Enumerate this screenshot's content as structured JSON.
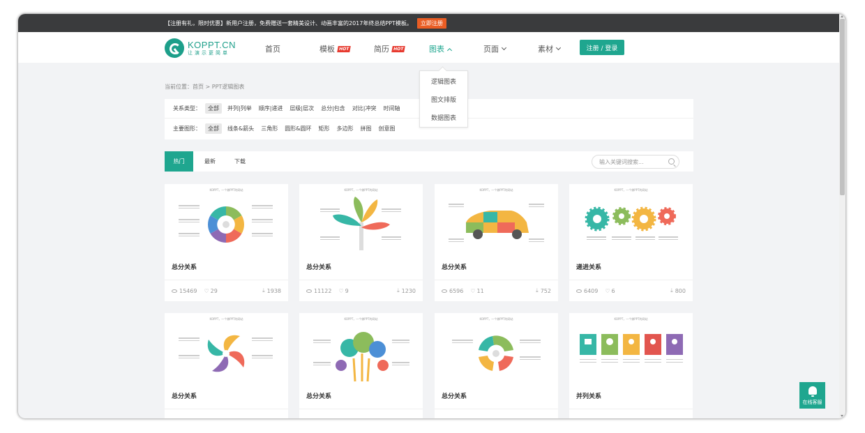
{
  "promo": {
    "text": "【注册有礼，限时优惠】新用户注册，免费赠送一套精美设计、动画丰富的2017年终总结PPT模板。",
    "button": "立即注册"
  },
  "logo": {
    "name": "KOPPT.CN",
    "slogan": "让演示更简单"
  },
  "nav": {
    "items": [
      {
        "label": "首页"
      },
      {
        "label": "模板",
        "badge": "HOT"
      },
      {
        "label": "简历",
        "badge": "HOT"
      },
      {
        "label": "图表"
      },
      {
        "label": "页面"
      },
      {
        "label": "素材"
      }
    ],
    "login": "注册 / 登录"
  },
  "dropdown": {
    "items": [
      "逻辑图表",
      "图文排版",
      "数据图表"
    ]
  },
  "breadcrumb": "当前位置：首页 > PPT逻辑图表",
  "filters": {
    "relation_label": "关系类型：",
    "relation_options": [
      "全部",
      "并列|列举",
      "顺序|递进",
      "层级|层次",
      "总分|包含",
      "对比|冲突",
      "时间轴"
    ],
    "shape_label": "主要图形：",
    "shape_options": [
      "全部",
      "线条&箭头",
      "三角形",
      "圆形&圆环",
      "矩形",
      "多边形",
      "拼图",
      "创意图"
    ]
  },
  "tabs": {
    "items": [
      "热门",
      "最新",
      "下载"
    ],
    "search_placeholder": "输入关键词搜索..."
  },
  "cards": [
    {
      "title": "总分关系",
      "views": "15469",
      "likes": "29",
      "downloads": "1938",
      "header": "KOPPT，一个做PPT的网站"
    },
    {
      "title": "总分关系",
      "views": "11122",
      "likes": "9",
      "downloads": "1230",
      "header": "KOPPT，一个做PPT的网站"
    },
    {
      "title": "总分关系",
      "views": "6596",
      "likes": "11",
      "downloads": "752",
      "header": "KOPPT，一个做PPT的网站"
    },
    {
      "title": "递进关系",
      "views": "6409",
      "likes": "6",
      "downloads": "800",
      "header": "KOPPT，一个做PPT的网站"
    },
    {
      "title": "总分关系",
      "header": "KOPPT，一个做PPT的网站"
    },
    {
      "title": "总分关系",
      "header": "KOPPT，一个做PPT的网站"
    },
    {
      "title": "总分关系",
      "header": "KOPPT，一个做PPT的网站"
    },
    {
      "title": "并列关系",
      "header": "KOPPT，一个做PPT的网站"
    }
  ],
  "service": "在线客服",
  "colors": {
    "accent": "#1fa68f",
    "promo_bg": "#3a3b3d",
    "register": "#ea5d24"
  }
}
